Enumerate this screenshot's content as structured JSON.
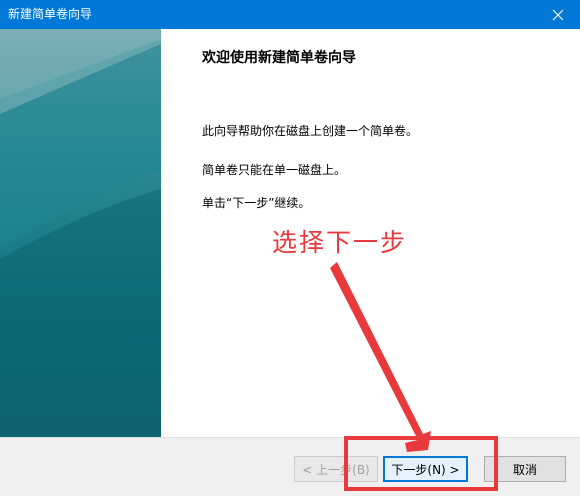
{
  "window": {
    "title": "新建简单卷向导",
    "close_icon": "close-icon"
  },
  "content": {
    "heading": "欢迎使用新建简单卷向导",
    "paragraphs": [
      "此向导帮助你在磁盘上创建一个简单卷。",
      "简单卷只能在单一磁盘上。",
      "单击“下一步”继续。"
    ]
  },
  "annotation": {
    "text": "选择下一步",
    "color": "#e8393c"
  },
  "buttons": {
    "back": "< 上一步(B)",
    "next": "下一步(N) >",
    "cancel": "取消"
  },
  "colors": {
    "titlebar": "#0078d7",
    "banner": "#0f7580",
    "accent": "#e8393c"
  }
}
